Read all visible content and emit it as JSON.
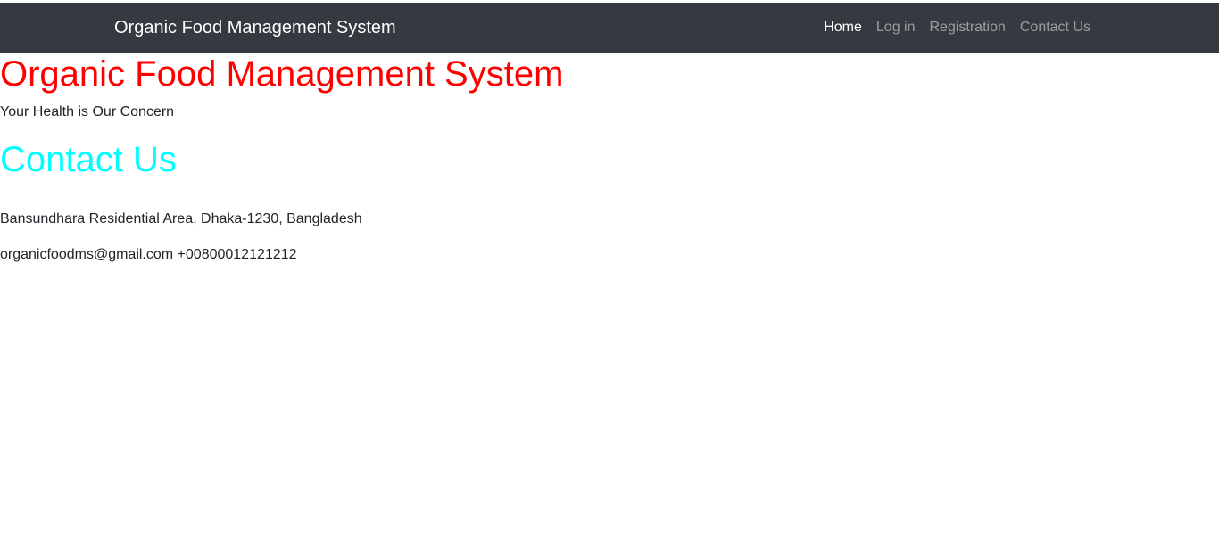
{
  "navbar": {
    "brand": "Organic Food Management System",
    "links": [
      {
        "label": "Home",
        "active": true
      },
      {
        "label": "Log in",
        "active": false
      },
      {
        "label": "Registration",
        "active": false
      },
      {
        "label": "Contact Us",
        "active": false
      }
    ]
  },
  "header": {
    "title": "Organic Food Management System",
    "tagline": "Your Health is Our Concern"
  },
  "contact": {
    "heading": "Contact Us",
    "address": "Bansundhara Residential Area, Dhaka-1230, Bangladesh",
    "email": "organicfoodms@gmail.com",
    "phone": "+00800012121212"
  },
  "colors": {
    "navbar_bg": "#343a40",
    "title": "#ff0000",
    "section_heading": "#00ffff"
  }
}
